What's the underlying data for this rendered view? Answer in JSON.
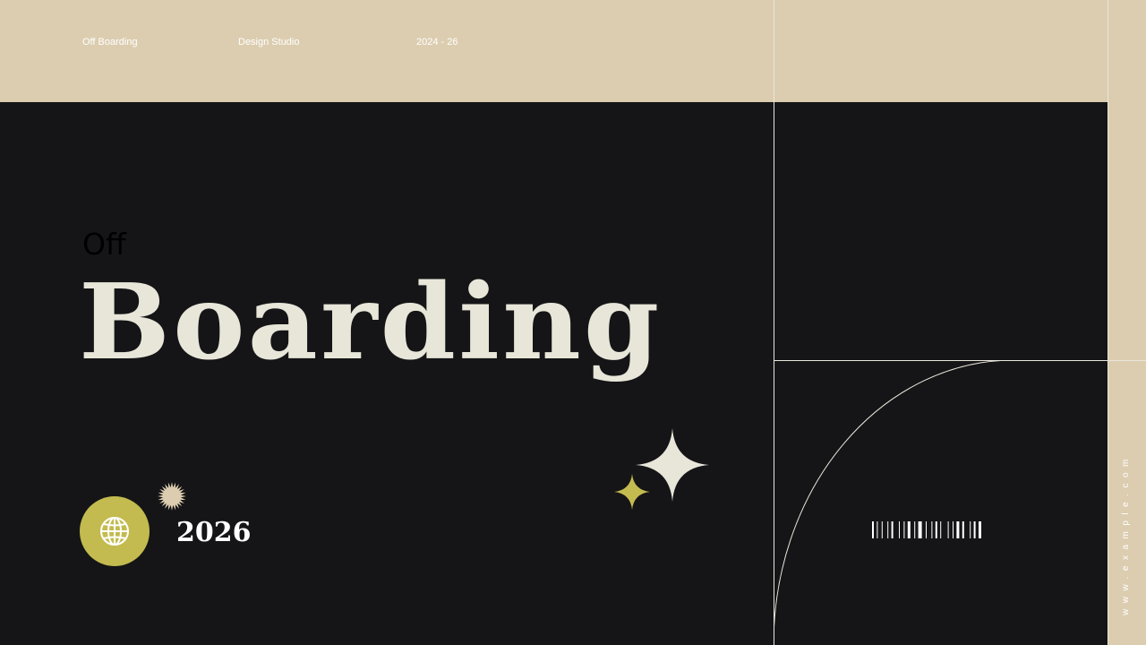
{
  "header": {
    "items": [
      "Off Boarding",
      "Design Studio",
      "2024 - 26"
    ]
  },
  "hero": {
    "subtitle": "Off",
    "title": "Boarding",
    "year": "2026"
  },
  "side": {
    "url": "www.example.com"
  },
  "icons": {
    "globe": "globe-icon",
    "burst": "starburst-icon",
    "sparkle_large": "sparkle-icon",
    "sparkle_small": "sparkle-icon",
    "barcode": "barcode-icon"
  },
  "colors": {
    "background": "#151517",
    "beige": "#dccdb0",
    "cream_text": "#e7e6d9",
    "olive": "#c3bb4f",
    "line": "#e8e6dc"
  }
}
